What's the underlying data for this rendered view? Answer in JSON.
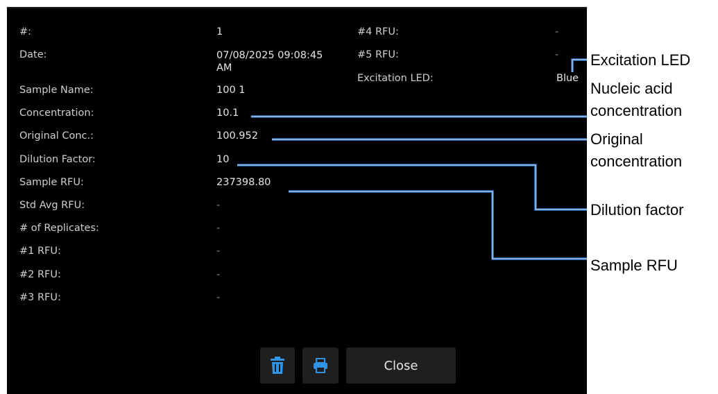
{
  "details": {
    "left": [
      {
        "label": "#:",
        "value": "1"
      },
      {
        "label": "Date:",
        "value": "07/08/2025 09:08:45 AM"
      },
      {
        "label": "Sample Name:",
        "value": "100 1"
      },
      {
        "label": "Concentration:",
        "value": "10.1"
      },
      {
        "label": "Original Conc.:",
        "value": "100.952"
      },
      {
        "label": "Dilution Factor:",
        "value": "10"
      },
      {
        "label": "Sample RFU:",
        "value": "237398.80"
      },
      {
        "label": "Std Avg RFU:",
        "value": "-"
      },
      {
        "label": "# of Replicates:",
        "value": "-"
      },
      {
        "label": "#1 RFU:",
        "value": "-"
      },
      {
        "label": "#2 RFU:",
        "value": "-"
      },
      {
        "label": "#3 RFU:",
        "value": "-"
      }
    ],
    "right": [
      {
        "label": "#4 RFU:",
        "value": "-"
      },
      {
        "label": "#5 RFU:",
        "value": "-"
      },
      {
        "label": "Excitation LED:",
        "value": "Blue"
      }
    ]
  },
  "buttons": {
    "delete_icon": "trash-icon",
    "print_icon": "printer-icon",
    "close_label": "Close"
  },
  "annotations": {
    "excitation_led": "Excitation LED",
    "nucleic_acid_concentration": "Nucleic acid concentration",
    "original_concentration": "Original concentration",
    "dilution_factor": "Dilution factor",
    "sample_rfu": "Sample RFU"
  },
  "colors": {
    "screen_bg": "#000000",
    "button_bg": "#1f1f1f",
    "icon_blue": "#2f93e6",
    "callout_line": "#1a5ea8"
  }
}
